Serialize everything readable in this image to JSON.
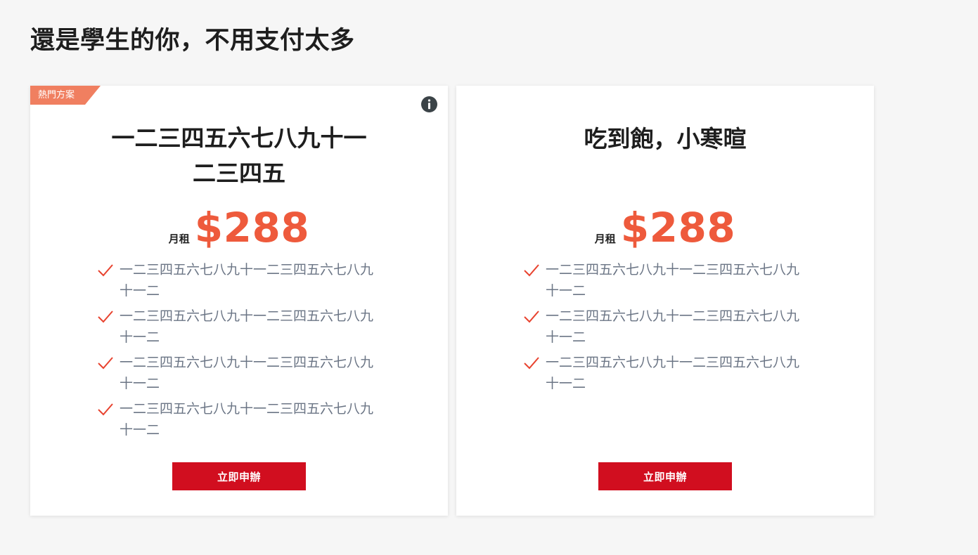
{
  "page": {
    "title": "還是學生的你，不用支付太多"
  },
  "colors": {
    "accent": "#ee5a3c",
    "button": "#d10e1f",
    "ribbon": "#f07f60",
    "feature_text": "#6b7585"
  },
  "cards": [
    {
      "badge": "熱門方案",
      "info_icon": "info-icon",
      "title_line1": "一二三四五六七八九十一",
      "title_line2": "二三四五",
      "price_unit": "月租",
      "price": "$288",
      "features": [
        "一二三四五六七八九十一二三四五六七八九十一二",
        "一二三四五六七八九十一二三四五六七八九十一二",
        "一二三四五六七八九十一二三四五六七八九十一二",
        "一二三四五六七八九十一二三四五六七八九十一二"
      ],
      "button_label": "立即申辦"
    },
    {
      "title_line1": "吃到飽，小寒暄",
      "price_unit": "月租",
      "price": "$288",
      "features": [
        "一二三四五六七八九十一二三四五六七八九十一二",
        "一二三四五六七八九十一二三四五六七八九十一二",
        "一二三四五六七八九十一二三四五六七八九十一二"
      ],
      "button_label": "立即申辦"
    }
  ]
}
